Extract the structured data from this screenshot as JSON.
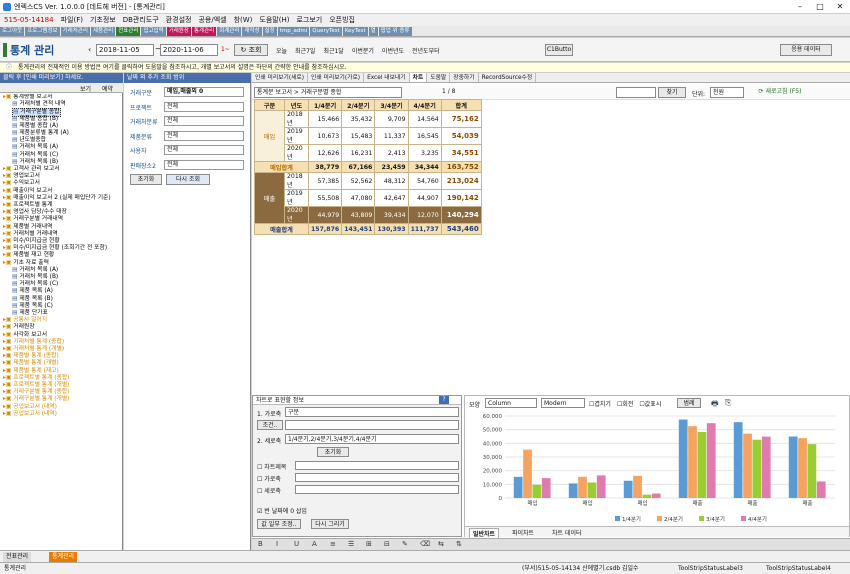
{
  "window": {
    "title": "엔렉스CS Ver. 1.0.0.0 [데트헤 버전] - [통계관리]"
  },
  "menu": [
    "515-05-14184",
    "파일(F)",
    "기초정보",
    "DB관리도구",
    "환경설정",
    "공용/엑셀",
    "창(W)",
    "도움말(H)",
    "로그보기",
    "오픈빙집"
  ],
  "toolbar": [
    {
      "label": "로그아웃",
      "color": "#6f8faf"
    },
    {
      "label": "프로그램정보",
      "color": "#6f8faf"
    },
    {
      "label": "거래처관리",
      "color": "#6f8faf"
    },
    {
      "label": "제품관리",
      "color": "#6f8faf"
    },
    {
      "label": "전표관리",
      "color": "#2e7d32"
    },
    {
      "label": "입고입력",
      "color": "#6f8faf"
    },
    {
      "label": "거래원장",
      "color": "#c2185b"
    },
    {
      "label": "통계관리",
      "color": "#c2185b"
    },
    {
      "label": "회계관리",
      "color": "#6f8faf"
    },
    {
      "label": "재작성",
      "color": "#6f8faf"
    },
    {
      "label": "설정",
      "color": "#6f8faf"
    },
    {
      "label": "tmp_admi",
      "color": "#6f8faf"
    },
    {
      "label": "QueryTest",
      "color": "#6f8faf"
    },
    {
      "label": "KeyTest",
      "color": "#6f8faf"
    },
    {
      "label": "열",
      "color": "#6f8faf"
    },
    {
      "label": "팝업 위 종류",
      "color": "#6f8faf"
    }
  ],
  "filter": {
    "page_title": "통계 관리",
    "date_from": "2018-11-05",
    "date_to": "2020-11-06",
    "period_label": "1~",
    "search_button": "조회",
    "quick": [
      "오늘",
      "최근7일",
      "최근1달",
      "이번분기",
      "이번년도",
      "전년도부터"
    ],
    "c1_button": "C1Butto",
    "setting_button": "응용 데이터"
  },
  "info": "통계관리의 전체적인 이용 방법은 여기를 클릭하여 도움말을 참조하시고, 개별 보고서의 설명은 하단의 간략한 안내를 참조하십시오.",
  "left": {
    "header": "클릭 후 [인쇄 미리보기] 하세요.",
    "tabs": [
      "보기",
      "예약"
    ],
    "tree": [
      {
        "t": "통계량별 보고서",
        "l": 1,
        "c": "#000"
      },
      {
        "t": "거래처별 견적 내역",
        "l": 2,
        "c": "#000"
      },
      {
        "t": "거래구분별 종합",
        "l": 2,
        "c": "#000",
        "sel": true
      },
      {
        "t": "제품별 종합 (B)",
        "l": 2,
        "c": "#000"
      },
      {
        "t": "제품별 종합 (A)",
        "l": 2,
        "c": "#000"
      },
      {
        "t": "제품분류별 통계 (A)",
        "l": 2,
        "c": "#000"
      },
      {
        "t": "년도별종합",
        "l": 2,
        "c": "#000"
      },
      {
        "t": "거래처 목록 (A)",
        "l": 2,
        "c": "#000"
      },
      {
        "t": "거래처 목록 (C)",
        "l": 2,
        "c": "#000"
      },
      {
        "t": "거래처 목록 (B)",
        "l": 2,
        "c": "#000"
      },
      {
        "t": "고객사 관리 보고서",
        "l": 1,
        "c": "#000"
      },
      {
        "t": "영업보고서",
        "l": 1,
        "c": "#000"
      },
      {
        "t": "수익보고서",
        "l": 1,
        "c": "#000"
      },
      {
        "t": "매출이익 보고서",
        "l": 1,
        "c": "#000"
      },
      {
        "t": "매출이익 보고서 2 (실제 매입단가 기준)",
        "l": 1,
        "c": "#000"
      },
      {
        "t": "프로젝트별 통계",
        "l": 1,
        "c": "#000"
      },
      {
        "t": "영업사 담당/수수 대장",
        "l": 1,
        "c": "#000"
      },
      {
        "t": "거래구분별 거래내역",
        "l": 1,
        "c": "#000"
      },
      {
        "t": "제품별 거래내역",
        "l": 1,
        "c": "#000"
      },
      {
        "t": "거래처별 거래내역",
        "l": 1,
        "c": "#000"
      },
      {
        "t": "미수/미지급금 현황",
        "l": 1,
        "c": "#000"
      },
      {
        "t": "미수/미지급금 현황 (조회기간 전 포함)",
        "l": 1,
        "c": "#000"
      },
      {
        "t": "제품별 재고 현황",
        "l": 1,
        "c": "#000"
      },
      {
        "t": "기초 자료 출력",
        "l": 1,
        "c": "#000"
      },
      {
        "t": "거래처 목록 (A)",
        "l": 2,
        "c": "#000"
      },
      {
        "t": "거래처 목록 (B)",
        "l": 2,
        "c": "#000"
      },
      {
        "t": "거래처 목록 (C)",
        "l": 2,
        "c": "#000"
      },
      {
        "t": "제품 목록 (A)",
        "l": 2,
        "c": "#000"
      },
      {
        "t": "제품 목록 (B)",
        "l": 2,
        "c": "#000"
      },
      {
        "t": "제품 목록 (C)",
        "l": 2,
        "c": "#000"
      },
      {
        "t": "제품 단가표",
        "l": 2,
        "c": "#000"
      },
      {
        "t": "공통사 일어지",
        "l": 1,
        "c": "#d98a00"
      },
      {
        "t": "거래원장",
        "l": 1,
        "c": "#000"
      },
      {
        "t": "사각화 보고서",
        "l": 1,
        "c": "#000"
      },
      {
        "t": "기래처별 통계 (종합)",
        "l": 1,
        "c": "#d98a00"
      },
      {
        "t": "거래처별 통계 (개별)",
        "l": 1,
        "c": "#d98a00"
      },
      {
        "t": "제품별 통계 (종합)",
        "l": 1,
        "c": "#d98a00"
      },
      {
        "t": "제품별 통계 (개별)",
        "l": 1,
        "c": "#d98a00"
      },
      {
        "t": "제품별 통계 (재고)",
        "l": 1,
        "c": "#d98a00"
      },
      {
        "t": "프로젝트별 통계 (종합)",
        "l": 1,
        "c": "#d98a00"
      },
      {
        "t": "프로젝트별 통계 (개별)",
        "l": 1,
        "c": "#d98a00"
      },
      {
        "t": "거래구분별 통계 (종합)",
        "l": 1,
        "c": "#d98a00"
      },
      {
        "t": "거래구분별 통계 (개별)",
        "l": 1,
        "c": "#d98a00"
      },
      {
        "t": "공업보고서 (내역)",
        "l": 1,
        "c": "#d98a00"
      },
      {
        "t": "공업보고서 (내역)",
        "l": 1,
        "c": "#d98a00"
      }
    ]
  },
  "mid": {
    "header": "날짜 외 추가 조회 범위",
    "fields": [
      {
        "label": "거래구분",
        "value": "매입,매출외 0",
        "bold": true
      },
      {
        "label": "프로젝트",
        "value": "전체"
      },
      {
        "label": "거래처분류",
        "value": "전체"
      },
      {
        "label": "제품분류",
        "value": "전체"
      },
      {
        "label": "사용자",
        "value": "전체"
      },
      {
        "label": "판매장소2",
        "value": "전체"
      }
    ],
    "init_button": "초기화",
    "refresh_button": "다시 조회"
  },
  "tabs": [
    "인쇄 미리보기(세로)",
    "인쇄 미리보기(가로)",
    "Excel 내보내기",
    "차트",
    "도움말",
    "장중하기",
    "RecordSource수정"
  ],
  "report": {
    "title_combo": "통계분 보고서 > 거래구분별 종합",
    "page": "1 / 8",
    "find_button": "찾기",
    "unit_label": "단위:",
    "unit_value": "천원",
    "refresh_label": "새로고침 (F5)",
    "headers": [
      "구분",
      "년도",
      "1/4분기",
      "2/4분기",
      "3/4분기",
      "4/4분기",
      "합계"
    ],
    "rows": [
      {
        "g": "매입",
        "y": "2018년",
        "v": [
          "15,466",
          "35,432",
          "9,709",
          "14,564",
          "75,162"
        ]
      },
      {
        "g": "",
        "y": "2019년",
        "v": [
          "10,673",
          "15,483",
          "11,337",
          "16,545",
          "54,039"
        ]
      },
      {
        "g": "",
        "y": "2020년",
        "v": [
          "12,626",
          "16,231",
          "2,413",
          "3,235",
          "34,551"
        ]
      },
      {
        "sub": "매입합계",
        "v": [
          "38,779",
          "67,166",
          "23,459",
          "34,344",
          "163,752"
        ]
      },
      {
        "g": "매출",
        "y": "2018년",
        "v": [
          "57,385",
          "52,562",
          "48,312",
          "54,760",
          "213,024"
        ]
      },
      {
        "g": "",
        "y": "2019년",
        "v": [
          "55,508",
          "47,080",
          "42,647",
          "44,907",
          "190,142"
        ]
      },
      {
        "g": "",
        "y": "2020년",
        "v": [
          "44,979",
          "43,809",
          "39,434",
          "12,070",
          "140,294"
        ],
        "dk": true
      },
      {
        "sub": "매출합계",
        "v": [
          "157,876",
          "143,451",
          "130,393",
          "111,737",
          "543,460"
        ],
        "tot": true
      }
    ]
  },
  "chartopt": {
    "title": "차트로 표현할 정보",
    "axis1_label": "1. 가로축",
    "axis1_value": "구분",
    "cond_button": "조건..",
    "axis2_label": "2. 세로축",
    "axis2_value": "1/4분기,2/4분기,3/4분기,4/4분기",
    "init_button": "초기화",
    "checks": [
      "차트제목",
      "가로축",
      "세로축"
    ],
    "legend_check": "번 날짜에 0 삽입",
    "btn1": "값 일부 조정..",
    "btn2": "다시 그리기"
  },
  "chart": {
    "shape_label": "모양",
    "shape": "Column",
    "style": "Modern",
    "opts": [
      "겹치기",
      "회전",
      "값표시"
    ],
    "legend_btn": "범례",
    "tabs": [
      "일반차트",
      "파이차트",
      "차트 데이터"
    ]
  },
  "chart_data": {
    "type": "bar",
    "categories": [
      "매입",
      "매입",
      "매입",
      "매출",
      "매출",
      "매출"
    ],
    "series": [
      {
        "name": "1/4분기",
        "values": [
          15466,
          10673,
          12626,
          57385,
          55508,
          44979
        ]
      },
      {
        "name": "2/4분기",
        "values": [
          35432,
          15483,
          16231,
          52562,
          47080,
          43809
        ]
      },
      {
        "name": "3/4분기",
        "values": [
          9709,
          11337,
          2413,
          48312,
          42647,
          39434
        ]
      },
      {
        "name": "4/4분기",
        "values": [
          14564,
          16545,
          3235,
          54760,
          44907,
          12070
        ]
      }
    ],
    "ylim": [
      0,
      60000
    ],
    "yticks": [
      "0",
      "10,000",
      "20,000",
      "30,000",
      "40,000",
      "50,000",
      "60,000"
    ],
    "colors": [
      "#5b9bd5",
      "#f4a460",
      "#9acd32",
      "#e07bb0"
    ],
    "legend": "bottom"
  },
  "taskbar": [
    "전표관리",
    "통계관리"
  ],
  "status": {
    "left": "통계관리",
    "mid": "(부서)515-05-14134 산에별기.csdb",
    "user": "김일수",
    "right1": "ToolStripStatusLabel3",
    "right2": "ToolStripStatusLabel4"
  }
}
